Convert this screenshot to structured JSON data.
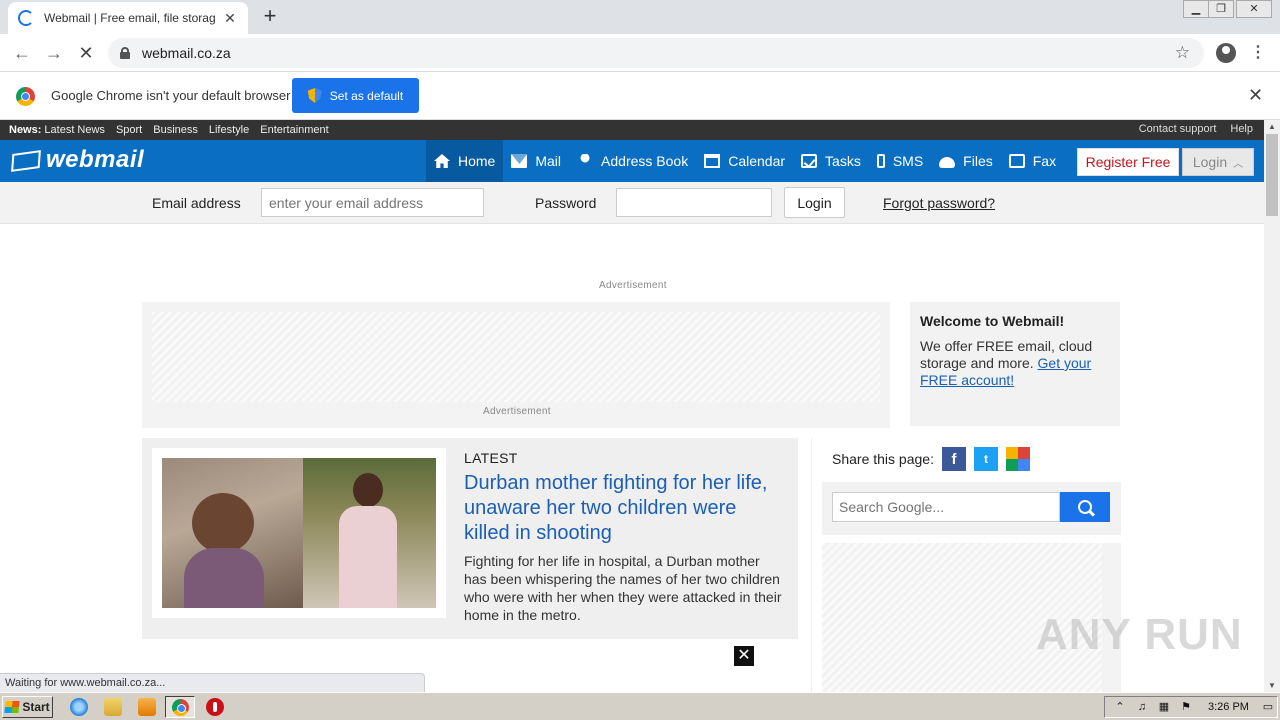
{
  "browser": {
    "tab_title": "Webmail | Free email, file storage, s",
    "url": "webmail.co.za",
    "info_text": "Google Chrome isn't your default browser",
    "set_default_label": "Set as default",
    "status_text": "Waiting for www.webmail.co.za..."
  },
  "newsbar": {
    "prefix": "News:",
    "links": [
      "Latest News",
      "Sport",
      "Business",
      "Lifestyle",
      "Entertainment"
    ],
    "right_links": [
      "Contact support",
      "Help"
    ]
  },
  "nav": {
    "logo": "webmail",
    "items": [
      {
        "label": "Home",
        "icon": "home-icon"
      },
      {
        "label": "Mail",
        "icon": "envelope-icon"
      },
      {
        "label": "Address Book",
        "icon": "user-icon"
      },
      {
        "label": "Calendar",
        "icon": "calendar-icon"
      },
      {
        "label": "Tasks",
        "icon": "checkbox-icon"
      },
      {
        "label": "SMS",
        "icon": "phone-icon"
      },
      {
        "label": "Files",
        "icon": "cloud-download-icon"
      },
      {
        "label": "Fax",
        "icon": "fax-icon"
      }
    ],
    "register_label": "Register Free",
    "login_label": "Login",
    "accent_color": "#0a6fc2"
  },
  "loginbar": {
    "email_label": "Email address",
    "email_placeholder": "enter your email address",
    "password_label": "Password",
    "login_button": "Login",
    "forgot_link": "Forgot password?"
  },
  "ads": {
    "top_label": "Advertisement",
    "box_label": "Advertisement"
  },
  "welcome": {
    "title": "Welcome to Webmail!",
    "text": "We offer FREE email, cloud storage and more.",
    "link": "Get your FREE account!"
  },
  "article": {
    "tag": "LATEST",
    "title": "Durban mother fighting for her life, unaware her two children were killed in shooting",
    "description": "Fighting for her life in hospital, a Durban mother has been whispering the names of her two children who were with her when they were attacked in their home in the metro."
  },
  "sidebar": {
    "share_label": "Share this page:",
    "search_placeholder": "Search Google..."
  },
  "watermark": "ANY RUN",
  "taskbar": {
    "start_label": "Start",
    "clock": "3:26 PM"
  }
}
